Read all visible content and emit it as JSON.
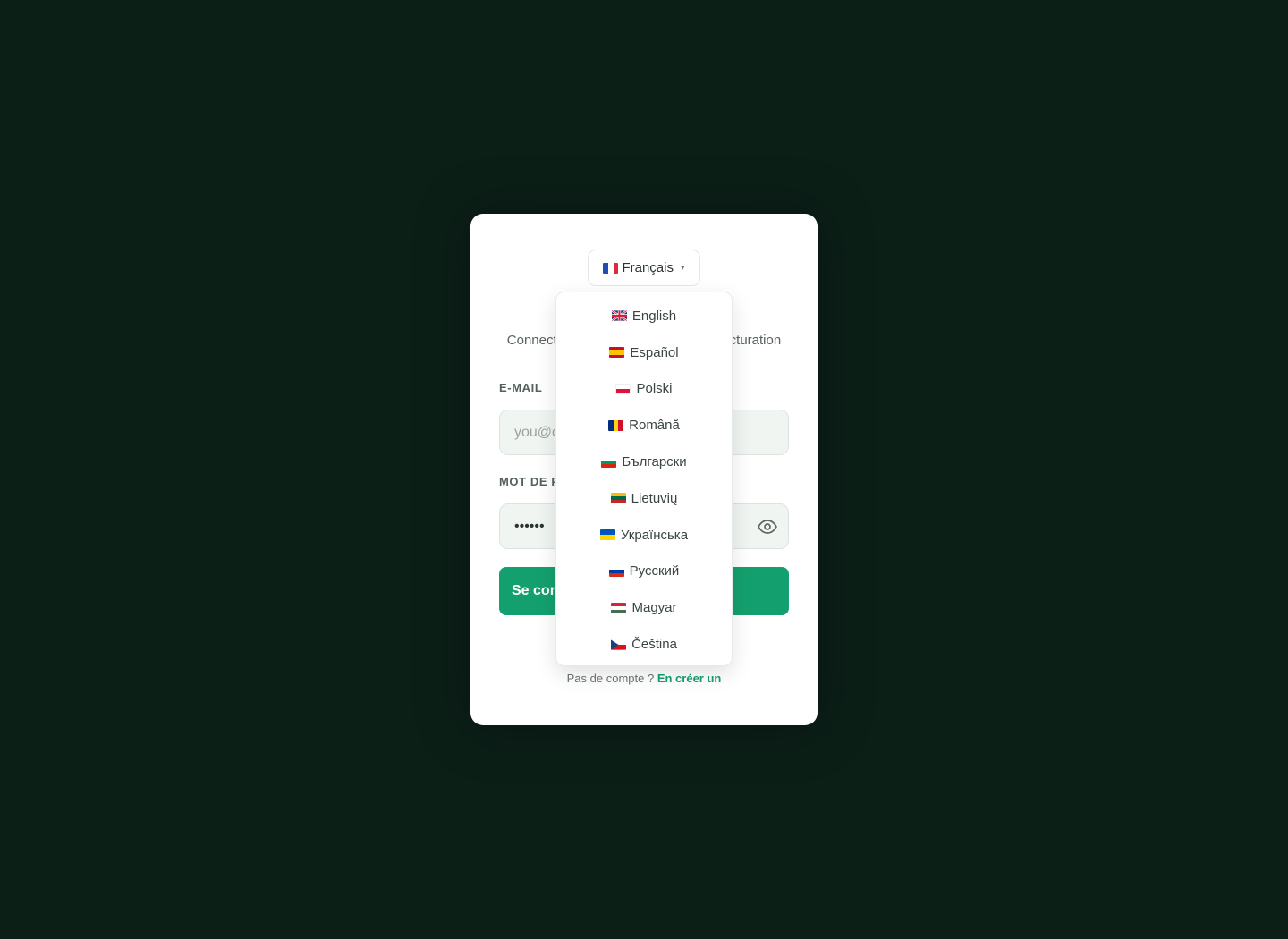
{
  "language_selector": {
    "current_label": "Français",
    "caret": "▾",
    "options": [
      {
        "label": "English",
        "flag": "uk-flag-icon"
      },
      {
        "label": "Español",
        "flag": "spain-flag-icon"
      },
      {
        "label": "Polski",
        "flag": "poland-flag-icon"
      },
      {
        "label": "Română",
        "flag": "romania-flag-icon"
      },
      {
        "label": "Български",
        "flag": "bulgaria-flag-icon"
      },
      {
        "label": "Lietuvių",
        "flag": "lithuania-flag-icon"
      },
      {
        "label": "Українська",
        "flag": "ukraine-flag-icon"
      },
      {
        "label": "Русский",
        "flag": "russia-flag-icon"
      },
      {
        "label": "Magyar",
        "flag": "hungary-flag-icon"
      },
      {
        "label": "Čeština",
        "flag": "czech-flag-icon"
      }
    ]
  },
  "subtitle": {
    "left_fragment": "Connect",
    "right_fragment": "cturation"
  },
  "email": {
    "label": "E-MAIL",
    "placeholder": "you@c"
  },
  "password": {
    "label_fragment": "MOT DE P",
    "value": "••••••"
  },
  "submit": {
    "label_fragment": "Se con"
  },
  "signup": {
    "prompt": "Pas de compte ?",
    "link": "En créer un"
  },
  "colors": {
    "background": "#0b1f17",
    "card": "#ffffff",
    "accent": "#14a06e",
    "input_bg": "#f1f5f2"
  }
}
